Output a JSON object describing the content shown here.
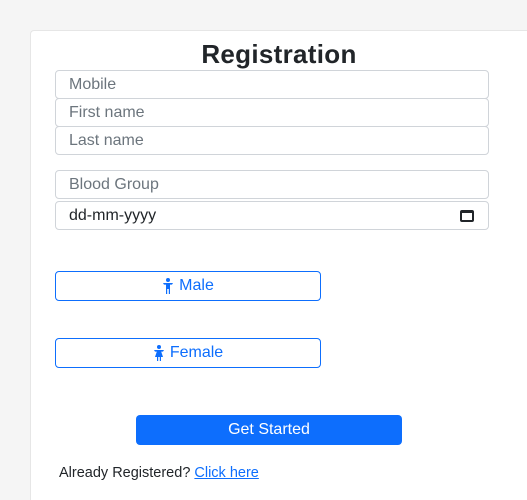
{
  "form": {
    "title": "Registration",
    "fields": {
      "mobile_placeholder": "Mobile",
      "first_name_placeholder": "First name",
      "last_name_placeholder": "Last name",
      "blood_group_placeholder": "Blood Group",
      "date_placeholder": "dd-mm-yyyy"
    },
    "gender": {
      "male_label": "Male",
      "female_label": "Female"
    },
    "submit_label": "Get Started",
    "footer": {
      "text": "Already Registered?",
      "link_label": "Click here"
    }
  },
  "colors": {
    "accent": "#0d6efd",
    "text": "#212529",
    "placeholder": "#6c757d",
    "border": "#d0d4d9",
    "background": "#f5f5f5"
  },
  "icons": {
    "gender": "person-standing-icon",
    "date": "calendar-icon"
  }
}
